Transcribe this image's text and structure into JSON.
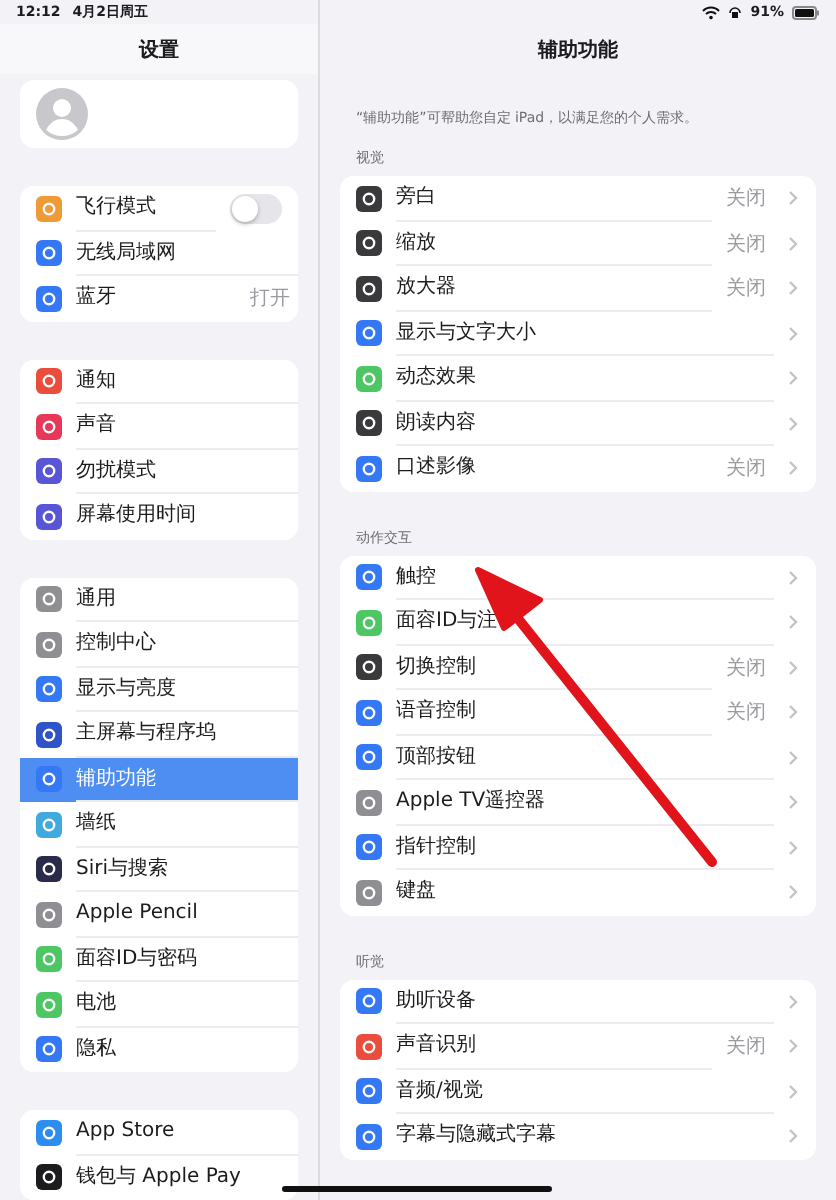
{
  "status_bar": {
    "time": "12:12",
    "date": "4月2日周五",
    "battery": "91%"
  },
  "sidebar": {
    "title": "设置",
    "groups": [
      {
        "items": [
          {
            "label": "飞行模式",
            "color": "#f09a37",
            "kind": "toggle",
            "on": false,
            "selected": false
          },
          {
            "label": "无线局域网",
            "color": "#3478f6",
            "kind": "link",
            "selected": false
          },
          {
            "label": "蓝牙",
            "color": "#3478f6",
            "kind": "value",
            "value": "打开",
            "selected": false
          }
        ]
      },
      {
        "items": [
          {
            "label": "通知",
            "color": "#eb4d3d",
            "kind": "link",
            "selected": false
          },
          {
            "label": "声音",
            "color": "#e8385a",
            "kind": "link",
            "selected": false
          },
          {
            "label": "勿扰模式",
            "color": "#5856d6",
            "kind": "link",
            "selected": false
          },
          {
            "label": "屏幕使用时间",
            "color": "#5856d6",
            "kind": "link",
            "selected": false
          }
        ]
      },
      {
        "items": [
          {
            "label": "通用",
            "color": "#8e8e93",
            "kind": "link",
            "selected": false
          },
          {
            "label": "控制中心",
            "color": "#8e8e93",
            "kind": "link",
            "selected": false
          },
          {
            "label": "显示与亮度",
            "color": "#3478f6",
            "kind": "link",
            "selected": false
          },
          {
            "label": "主屏幕与程序坞",
            "color": "#2f54c8",
            "kind": "link",
            "selected": false
          },
          {
            "label": "辅助功能",
            "color": "#3478f6",
            "kind": "link",
            "selected": true
          },
          {
            "label": "墙纸",
            "color": "#40a9e0",
            "kind": "link",
            "selected": false
          },
          {
            "label": "Siri与搜索",
            "color": "#2a2a4a",
            "kind": "link",
            "selected": false
          },
          {
            "label": "Apple Pencil",
            "color": "#8e8e93",
            "kind": "link",
            "selected": false
          },
          {
            "label": "面容ID与密码",
            "color": "#4cc764",
            "kind": "link",
            "selected": false
          },
          {
            "label": "电池",
            "color": "#4cc764",
            "kind": "link",
            "selected": false
          },
          {
            "label": "隐私",
            "color": "#3478f6",
            "kind": "link",
            "selected": false
          }
        ]
      },
      {
        "items": [
          {
            "label": "App Store",
            "color": "#2d8cf0",
            "kind": "link",
            "selected": false
          },
          {
            "label": "钱包与 Apple Pay",
            "color": "#1c1c1e",
            "kind": "link",
            "selected": false
          }
        ]
      }
    ]
  },
  "detail": {
    "title": "辅助功能",
    "description": "“辅助功能”可帮助您自定 iPad，以满足您的个人需求。",
    "sections": [
      {
        "header": "视觉",
        "rows": [
          {
            "label": "旁白",
            "color": "#3a3a3c",
            "value": "关闭"
          },
          {
            "label": "缩放",
            "color": "#3a3a3c",
            "value": "关闭"
          },
          {
            "label": "放大器",
            "color": "#3a3a3c",
            "value": "关闭"
          },
          {
            "label": "显示与文字大小",
            "color": "#3478f6"
          },
          {
            "label": "动态效果",
            "color": "#4cc764"
          },
          {
            "label": "朗读内容",
            "color": "#3a3a3c"
          },
          {
            "label": "口述影像",
            "color": "#3478f6",
            "value": "关闭"
          }
        ]
      },
      {
        "header": "动作交互",
        "rows": [
          {
            "label": "触控",
            "color": "#3478f6"
          },
          {
            "label": "面容ID与注",
            "color": "#4cc764"
          },
          {
            "label": "切换控制",
            "color": "#3a3a3c",
            "value": "关闭"
          },
          {
            "label": "语音控制",
            "color": "#3478f6",
            "value": "关闭"
          },
          {
            "label": "顶部按钮",
            "color": "#3478f6"
          },
          {
            "label": "Apple TV遥控器",
            "color": "#8e8e93"
          },
          {
            "label": "指针控制",
            "color": "#3478f6"
          },
          {
            "label": "键盘",
            "color": "#8e8e93"
          }
        ]
      },
      {
        "header": "听觉",
        "rows": [
          {
            "label": "助听设备",
            "color": "#3478f6"
          },
          {
            "label": "声音识别",
            "color": "#eb4d3d",
            "value": "关闭"
          },
          {
            "label": "音频/视觉",
            "color": "#3478f6"
          },
          {
            "label": "字幕与隐藏式字幕",
            "color": "#3478f6"
          }
        ]
      }
    ]
  }
}
